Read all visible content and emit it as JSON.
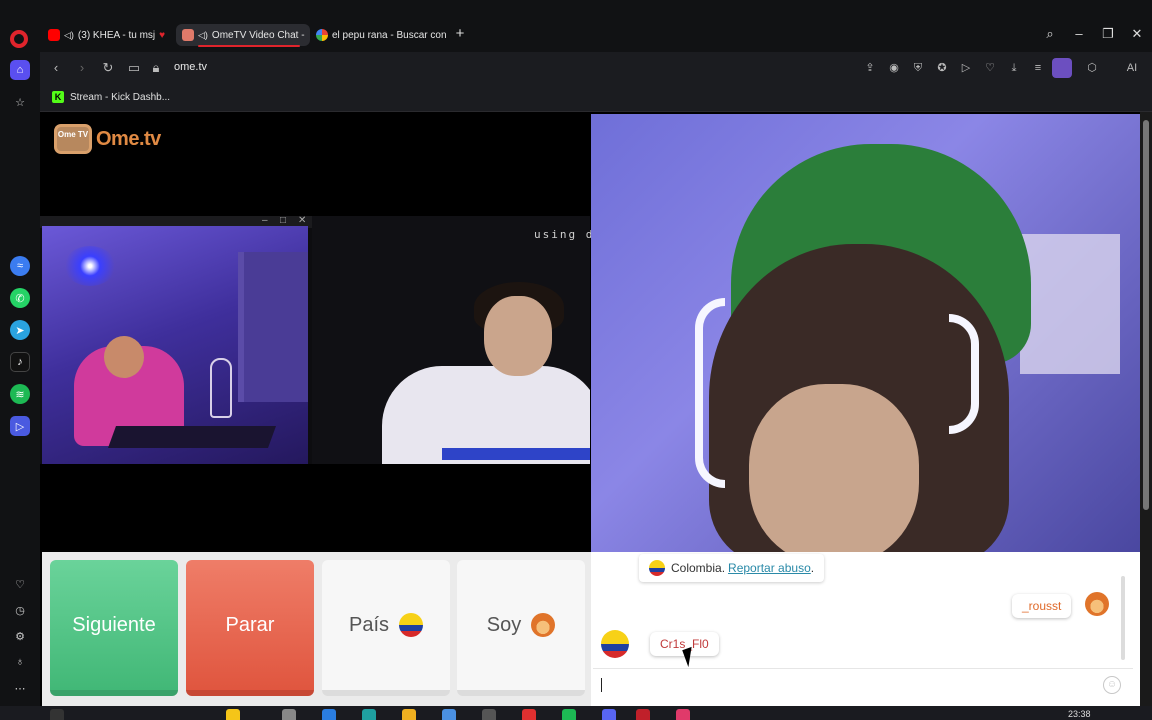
{
  "browser": {
    "tabs": [
      {
        "label": "(3) KHEA - tu msj",
        "icon": "youtube-icon",
        "muted": true,
        "active": false
      },
      {
        "label": "OmeTV Video Chat -",
        "icon": "ometv-icon",
        "muted": true,
        "active": true
      },
      {
        "label": "el pepu rana - Buscar con",
        "icon": "google-icon",
        "muted": false,
        "active": false
      }
    ],
    "address": "ome.tv",
    "bookmark": {
      "label": "Stream - Kick Dashb...",
      "icon": "kick-icon"
    },
    "aria_label": "AI"
  },
  "sidebar": {
    "items": [
      "home-icon",
      "star-icon",
      "messenger-icon",
      "whatsapp-icon",
      "telegram-icon",
      "tiktok-icon",
      "spotify-icon",
      "player-icon",
      "heart-icon",
      "history-icon",
      "settings-icon",
      "tips-icon",
      "more-icon"
    ]
  },
  "page": {
    "logo": {
      "badge": "Ome TV",
      "text": "Ome.tv"
    },
    "overlay_text": "using d",
    "controls": {
      "next_label": "Siguiente",
      "stop_label": "Parar",
      "country_label": "País",
      "gender_label": "Soy"
    },
    "chat": {
      "system_country": "Colombia.",
      "report_label": "Reportar abuso",
      "report_suffix": ".",
      "my_name": "_rousst",
      "their_name": "Cr1s_Fl0",
      "input_value": ""
    }
  },
  "taskbar": {
    "time": "23:38"
  },
  "colors": {
    "next": "#42b877",
    "stop": "#e0563f",
    "accent": "#e0242c",
    "link": "#2a8aa8"
  }
}
